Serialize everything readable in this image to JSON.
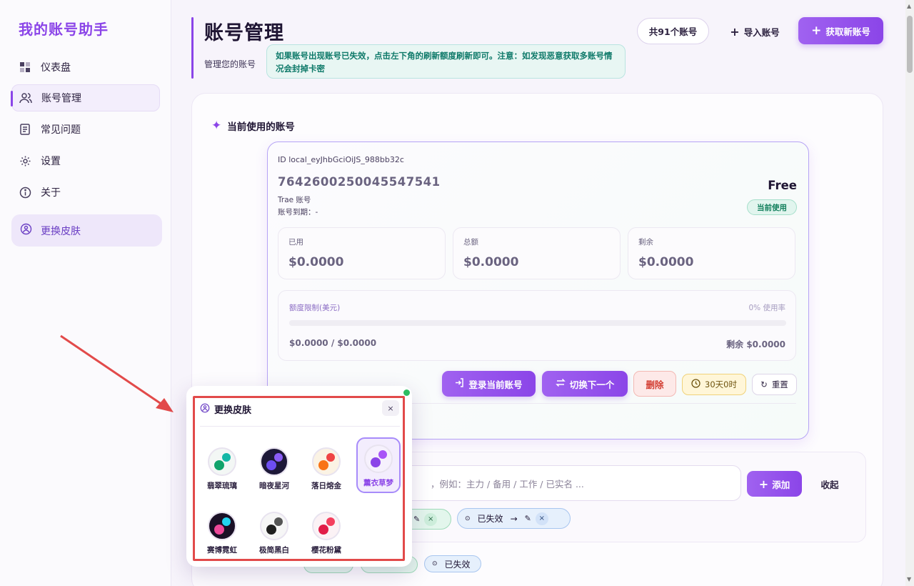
{
  "sidebar": {
    "brand": "我的账号助手",
    "items": [
      {
        "label": "仪表盘",
        "icon": "dashboard-icon"
      },
      {
        "label": "账号管理",
        "icon": "users-icon"
      },
      {
        "label": "常见问题",
        "icon": "book-icon"
      },
      {
        "label": "设置",
        "icon": "gear-icon"
      },
      {
        "label": "关于",
        "icon": "info-icon"
      }
    ],
    "skin_button": "更换皮肤"
  },
  "header": {
    "title": "账号管理",
    "subtitle": "管理您的账号",
    "notice": "如果账号出现账号已失效，点击左下角的刷新额度刷新即可。注意：如发现恶意获取多账号情况会封掉卡密",
    "count": "共91个账号",
    "import": "导入账号",
    "get_new": "获取新账号"
  },
  "current": {
    "section_title": "当前使用的账号",
    "id": "ID local_eyJhbGciOiJS_988bb32c",
    "number": "7642600250045547541",
    "type": "Trae 账号",
    "expire": "账号到期：-",
    "plan": "Free",
    "status": "当前使用",
    "stats": [
      {
        "label": "已用",
        "value": "$0.0000"
      },
      {
        "label": "总额",
        "value": "$0.0000"
      },
      {
        "label": "剩余",
        "value": "$0.0000"
      }
    ],
    "quota": {
      "label": "额度限制(美元)",
      "rate": "0% 使用率",
      "used": "$0.0000 / $0.0000",
      "remain": "剩余 $0.0000",
      "percent": 0
    },
    "actions": {
      "login": "登录当前账号",
      "switch": "切换下一个",
      "delete": "删除",
      "timer": "30天0时",
      "reset": "重置"
    }
  },
  "tags": {
    "placeholder": "，例如：主力 / 备用 / 工作 / 已实名 ...",
    "add": "添加",
    "collapse": "收起",
    "chip_expired": "已失效",
    "chip_expired2": "已失效"
  },
  "skin_popup": {
    "title": "更换皮肤",
    "close": "×",
    "skins": [
      {
        "name": "翡翠琉璃",
        "bg": "#f3f7f5",
        "c1": "#14b8a6",
        "c2": "#10a36a"
      },
      {
        "name": "暗夜星河",
        "bg": "#1d1838",
        "c1": "#8b5cf6",
        "c2": "#6d4df2"
      },
      {
        "name": "落日熔金",
        "bg": "#fbf3e4",
        "c1": "#ef4444",
        "c2": "#f97316"
      },
      {
        "name": "薰衣草梦",
        "bg": "#f6f1fd",
        "c1": "#a855f7",
        "c2": "#8b45e8"
      },
      {
        "name": "赛博霓虹",
        "bg": "#1a1026",
        "c1": "#22d3ee",
        "c2": "#ec4899"
      },
      {
        "name": "极简黑白",
        "bg": "#f6f6f6",
        "c1": "#555555",
        "c2": "#1f1f1f"
      },
      {
        "name": "樱花粉黛",
        "bg": "#fbf2f5",
        "c1": "#f43f5e",
        "c2": "#e11d48"
      }
    ]
  },
  "colors": {
    "accent": "#8b45e8",
    "highlight": "#e24a4a",
    "online": "#2ebd62"
  }
}
